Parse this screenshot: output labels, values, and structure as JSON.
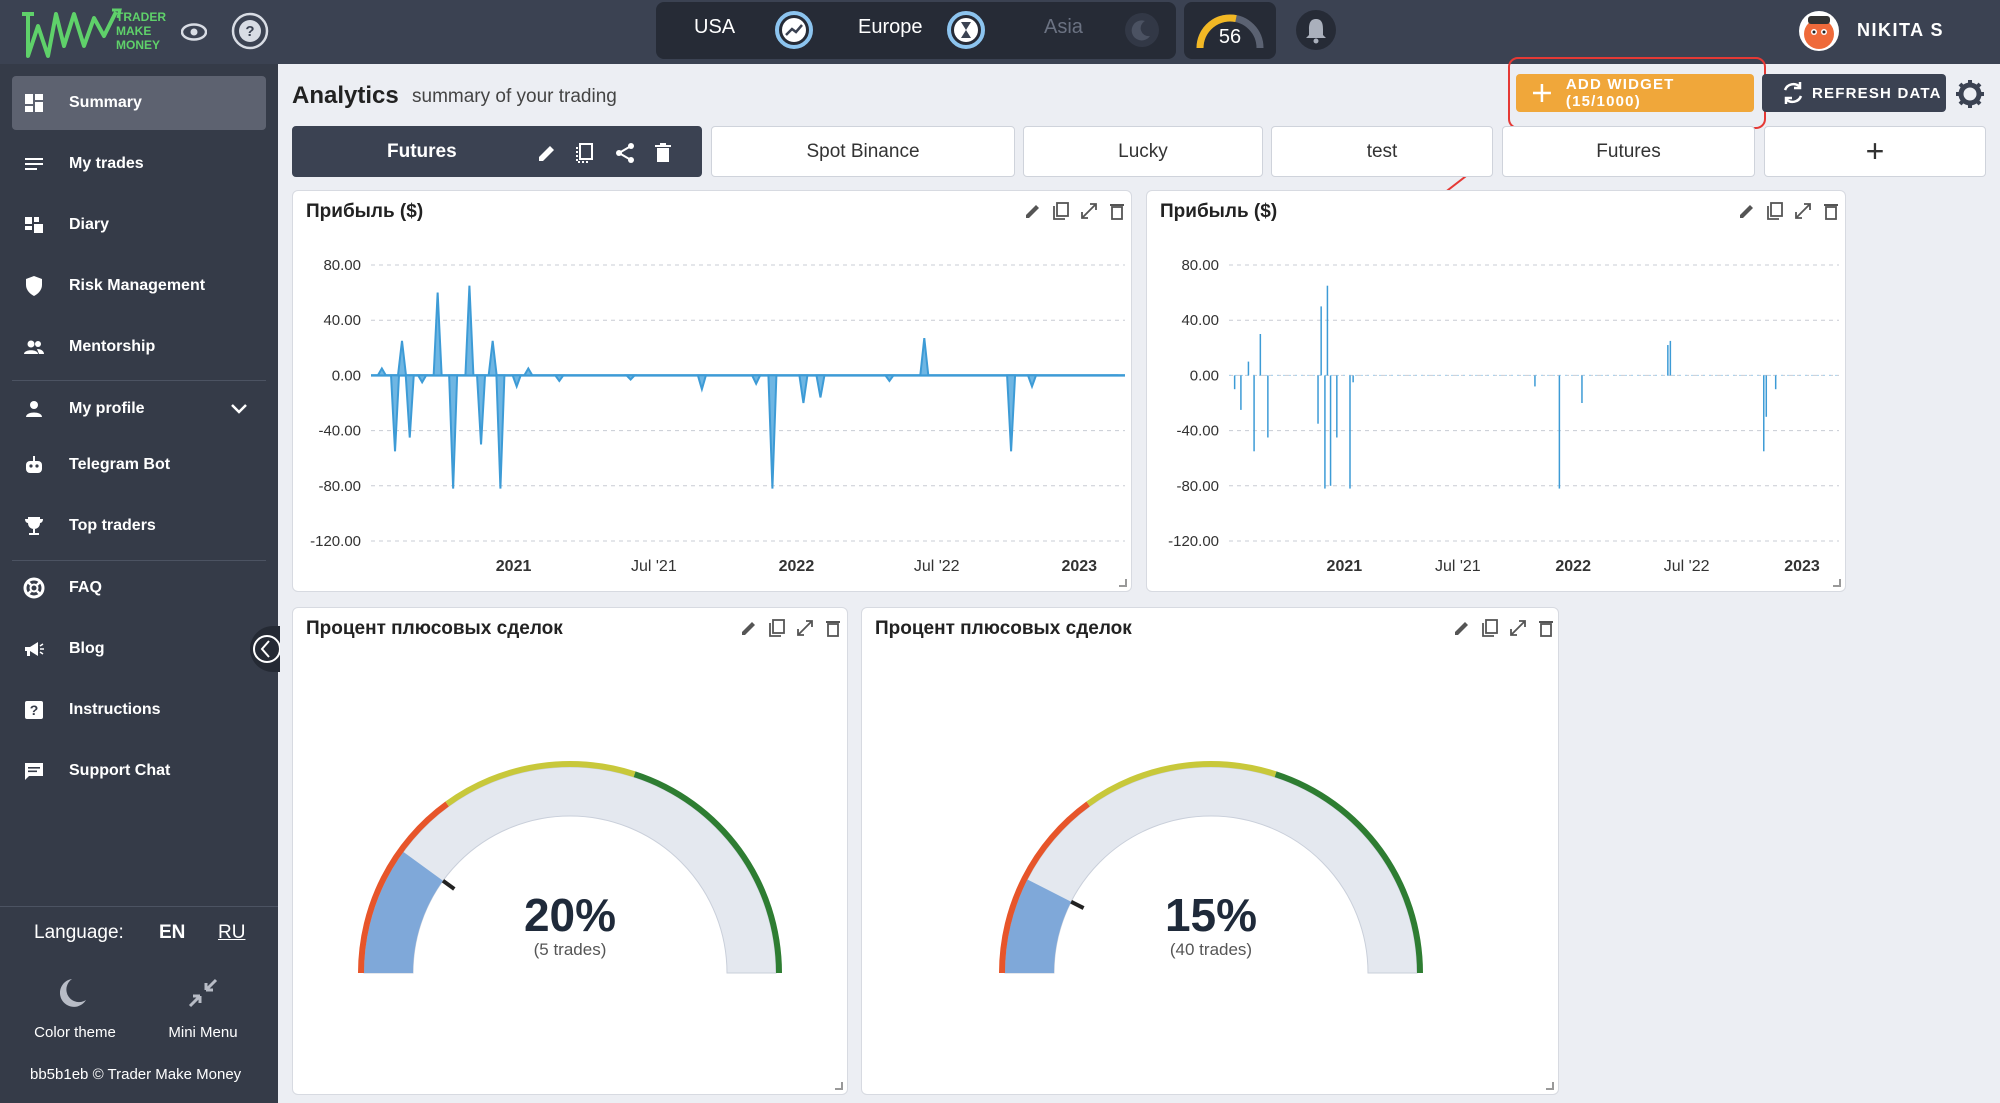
{
  "topbar": {
    "logo_lines": [
      "TRADER",
      "MAKE",
      "MONEY"
    ],
    "markets": [
      {
        "label": "USA",
        "state": "active"
      },
      {
        "label": "Europe",
        "state": "active"
      },
      {
        "label": "Asia",
        "state": "inactive"
      }
    ],
    "score": "56",
    "user_name": "NIKITA S"
  },
  "sidebar": {
    "items": [
      {
        "label": "Summary",
        "icon": "dashboard-icon"
      },
      {
        "label": "My trades",
        "icon": "list-icon"
      },
      {
        "label": "Diary",
        "icon": "diary-icon"
      },
      {
        "label": "Risk Management",
        "icon": "shield-icon"
      },
      {
        "label": "Mentorship",
        "icon": "group-icon"
      },
      {
        "label": "My profile",
        "icon": "person-icon"
      },
      {
        "label": "Telegram Bot",
        "icon": "robot-icon"
      },
      {
        "label": "Top traders",
        "icon": "trophy-icon"
      },
      {
        "label": "FAQ",
        "icon": "lifebuoy-icon"
      },
      {
        "label": "Blog",
        "icon": "megaphone-icon"
      },
      {
        "label": "Instructions",
        "icon": "help-square-icon"
      },
      {
        "label": "Support Chat",
        "icon": "chat-icon"
      }
    ],
    "language_label": "Language:",
    "lang_en": "EN",
    "lang_ru": "RU",
    "color_theme": "Color theme",
    "mini_menu": "Mini Menu",
    "footer": "bb5b1eb © Trader Make Money"
  },
  "header": {
    "title": "Analytics",
    "subtitle": "summary of your trading",
    "add_widget": "ADD WIDGET (15/1000)",
    "refresh": "REFRESH DATA"
  },
  "tabs": [
    "Futures",
    "Spot Binance",
    "Lucky",
    "test",
    "Futures",
    "+"
  ],
  "widgets": {
    "profit_title_1": "Прибыль ($)",
    "profit_title_2": "Прибыль ($)",
    "winrate_title_1": "Процент плюсовых сделок",
    "winrate_title_2": "Процент плюсовых сделок",
    "gauge_1": {
      "value": "20%",
      "sub": "(5 trades)",
      "fraction": 0.2
    },
    "gauge_2": {
      "value": "15%",
      "sub": "(40 trades)",
      "fraction": 0.15
    }
  },
  "colors": {
    "accent_orange": "#f0a73a",
    "dark": "#3b4252",
    "line_blue": "#3d9bd6",
    "highlight_red": "#e53935"
  },
  "chart_data": [
    {
      "type": "area",
      "title": "Прибыль ($)",
      "yticks": [
        "80.00",
        "40.00",
        "0.00",
        "-40.00",
        "-80.00",
        "-120.00"
      ],
      "xticks": [
        "2021",
        "Jul '21",
        "2022",
        "Jul '22",
        "2023"
      ],
      "ylim": [
        -120,
        80
      ],
      "x": [
        "2020-07-15",
        "2020-08-01",
        "2020-08-10",
        "2020-08-20",
        "2020-09-05",
        "2020-09-25",
        "2020-10-15",
        "2020-11-05",
        "2020-11-20",
        "2020-12-05",
        "2020-12-15",
        "2021-01-05",
        "2021-01-20",
        "2021-03-01",
        "2021-06-01",
        "2021-09-01",
        "2021-11-10",
        "2021-12-01",
        "2022-01-10",
        "2022-02-01",
        "2022-05-01",
        "2022-06-15",
        "2022-10-05",
        "2022-11-01",
        "2023-02-15"
      ],
      "series": [
        {
          "values": [
            5,
            -55,
            25,
            -45,
            -5,
            60,
            -82,
            65,
            -50,
            25,
            -82,
            -8,
            5,
            -4,
            -3,
            -10,
            -6,
            -82,
            -20,
            -16,
            -4,
            27,
            -55,
            -8,
            0
          ]
        }
      ]
    },
    {
      "type": "bar",
      "title": "Прибыль ($)",
      "yticks": [
        "80.00",
        "40.00",
        "0.00",
        "-40.00",
        "-80.00",
        "-120.00"
      ],
      "xticks": [
        "2021",
        "Jul '21",
        "2022",
        "Jul '22",
        "2023"
      ],
      "ylim": [
        -120,
        80
      ],
      "x": [
        "2020-07-10",
        "2020-07-20",
        "2020-08-01",
        "2020-08-10",
        "2020-08-20",
        "2020-09-01",
        "2020-11-20",
        "2020-11-25",
        "2020-12-01",
        "2020-12-05",
        "2020-12-10",
        "2020-12-20",
        "2021-01-10",
        "2021-01-15",
        "2021-11-01",
        "2021-12-10",
        "2022-01-15",
        "2022-06-01",
        "2022-06-05",
        "2022-11-01",
        "2022-11-05",
        "2022-11-20"
      ],
      "series": [
        {
          "values": [
            -10,
            -25,
            10,
            -55,
            30,
            -45,
            -35,
            50,
            -82,
            65,
            -80,
            -45,
            -82,
            -5,
            -8,
            -82,
            -20,
            22,
            25,
            -55,
            -30,
            -10
          ]
        }
      ]
    },
    {
      "type": "gauge",
      "title": "Процент плюсовых сделок",
      "value": 20,
      "trades": 5
    },
    {
      "type": "gauge",
      "title": "Процент плюсовых сделок",
      "value": 15,
      "trades": 40
    }
  ]
}
